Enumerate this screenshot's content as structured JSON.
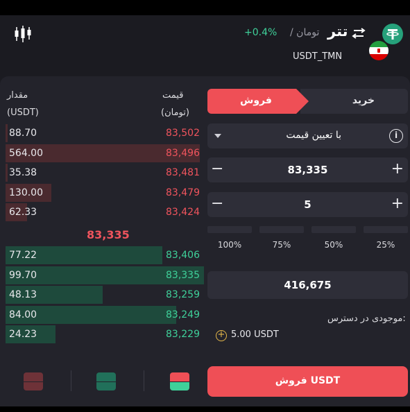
{
  "header": {
    "title": "تتر",
    "quote": "/ تومان",
    "change": "+0.4%",
    "pair": "USDT_TMN",
    "icons": {
      "chart": "candlestick-icon",
      "swap": "swap-icon",
      "coin": "tether-logo",
      "flag": "iran-flag"
    }
  },
  "colors": {
    "sell": "#ef4f56",
    "buy": "#3fd19a",
    "tether": "#26a17b"
  },
  "orderbook": {
    "amount_label": "مقدار",
    "amount_unit": "(USDT)",
    "price_label": "قیمت",
    "price_unit": "(تومان)",
    "asks": [
      {
        "amount": "88.70",
        "price": "83,502",
        "depth": 0.01
      },
      {
        "amount": "564.00",
        "price": "83,496",
        "depth": 0.98
      },
      {
        "amount": "35.38",
        "price": "83,481",
        "depth": 0.01
      },
      {
        "amount": "130.00",
        "price": "83,479",
        "depth": 0.23
      },
      {
        "amount": "62.33",
        "price": "83,424",
        "depth": 0.11
      }
    ],
    "mid_price": "83,335",
    "bids": [
      {
        "amount": "77.22",
        "price": "83,406",
        "depth": 0.79
      },
      {
        "amount": "99.70",
        "price": "83,335",
        "depth": 1.0
      },
      {
        "amount": "48.13",
        "price": "83,259",
        "depth": 0.49
      },
      {
        "amount": "84.00",
        "price": "83,249",
        "depth": 0.86
      },
      {
        "amount": "24.23",
        "price": "83,229",
        "depth": 0.25
      }
    ]
  },
  "trade": {
    "tab_buy": "خرید",
    "tab_sell": "فروش",
    "order_type": "با تعیین قیمت",
    "price_value": "83,335",
    "amount_value": "5",
    "minus": "−",
    "plus": "+",
    "percentages": [
      "100%",
      "75%",
      "50%",
      "25%"
    ],
    "total_value": "416,675",
    "available_label": "موجودی در دسترس:",
    "available_value": "5.00 USDT",
    "submit_label": "فروش USDT"
  }
}
